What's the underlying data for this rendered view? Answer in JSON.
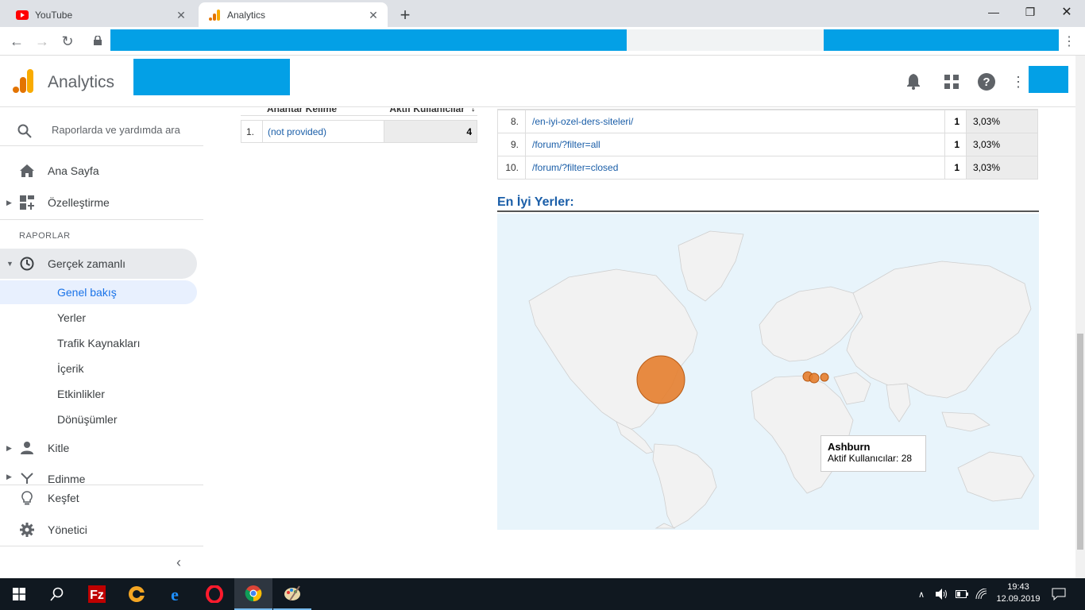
{
  "browser": {
    "tabs": [
      {
        "title": "YouTube"
      },
      {
        "title": "Analytics"
      }
    ]
  },
  "header": {
    "app_title": "Analytics"
  },
  "sidebar": {
    "search_placeholder": "Raporlarda ve yardımda ara",
    "home": "Ana Sayfa",
    "customization": "Özelleştirme",
    "section": "RAPORLAR",
    "realtime": "Gerçek zamanlı",
    "sub_items": [
      "Genel bakış",
      "Yerler",
      "Trafik Kaynakları",
      "İçerik",
      "Etkinlikler",
      "Dönüşümler"
    ],
    "audience": "Kitle",
    "acquisition": "Edinme",
    "discover": "Keşfet",
    "admin": "Yönetici"
  },
  "keywords": {
    "col_keyword": "Anahtar Kelime",
    "col_active": "Aktif Kullanıcılar",
    "rows": [
      {
        "idx": "1.",
        "keyword": "(not provided)",
        "count": "4"
      }
    ]
  },
  "pages": {
    "rows": [
      {
        "idx": "8.",
        "path": "/en-iyi-ozel-ders-siteleri/",
        "count": "1",
        "pct": "3,03%"
      },
      {
        "idx": "9.",
        "path": "/forum/?filter=all",
        "count": "1",
        "pct": "3,03%"
      },
      {
        "idx": "10.",
        "path": "/forum/?filter=closed",
        "count": "1",
        "pct": "3,03%"
      }
    ]
  },
  "locations": {
    "title": "En İyi Yerler:",
    "tooltip_city": "Ashburn",
    "tooltip_value": "Aktif Kullanıcılar: 28"
  },
  "taskbar": {
    "time": "19:43",
    "date": "12.09.2019"
  },
  "colors": {
    "accent": "#1a73e8",
    "bubble": "#e67e2e",
    "mask": "#03a0e6"
  }
}
